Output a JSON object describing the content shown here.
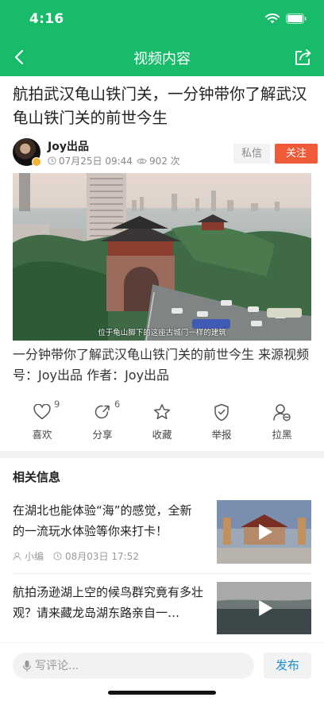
{
  "status_bar": {
    "time": "4:16",
    "icons": [
      "wifi-icon",
      "battery-icon"
    ]
  },
  "nav": {
    "title": "视频内容",
    "back_icon": "chevron-left-icon",
    "share_icon": "share-icon"
  },
  "article": {
    "title": "航拍武汉龟山铁门关，一分钟带你了解武汉龟山铁门关的前世今生",
    "author": "Joy出品",
    "date": "07月25日 09:44",
    "views": "902 次",
    "message_label": "私信",
    "follow_label": "关注",
    "video_caption": "位于龟山脚下的这座古城门一样的建筑",
    "description": "一分钟带你了解武汉龟山铁门关的前世今生 来源视频号：Joy出品 作者：Joy出品"
  },
  "actions": [
    {
      "label": "喜欢",
      "count": "9",
      "icon": "heart-icon"
    },
    {
      "label": "分享",
      "count": "6",
      "icon": "share-arrow-icon"
    },
    {
      "label": "收藏",
      "count": "",
      "icon": "star-icon"
    },
    {
      "label": "举报",
      "count": "",
      "icon": "shield-icon"
    },
    {
      "label": "拉黑",
      "count": "",
      "icon": "block-user-icon"
    }
  ],
  "related": {
    "title": "相关信息",
    "items": [
      {
        "title": "在湖北也能体验“海”的感觉，全新的一流玩水体验等你来打卡！",
        "author": "小编",
        "date": "08月03日 17:52"
      },
      {
        "title": "航拍汤逊湖上空的候鸟群究竟有多壮观？请来藏龙岛湖东路亲自一…"
      }
    ]
  },
  "comment": {
    "placeholder": "写评论...",
    "publish_label": "发布"
  },
  "colors": {
    "brand_green": "#17bb6a",
    "follow_red": "#ef5a39",
    "publish_blue": "#1b8fd6"
  }
}
